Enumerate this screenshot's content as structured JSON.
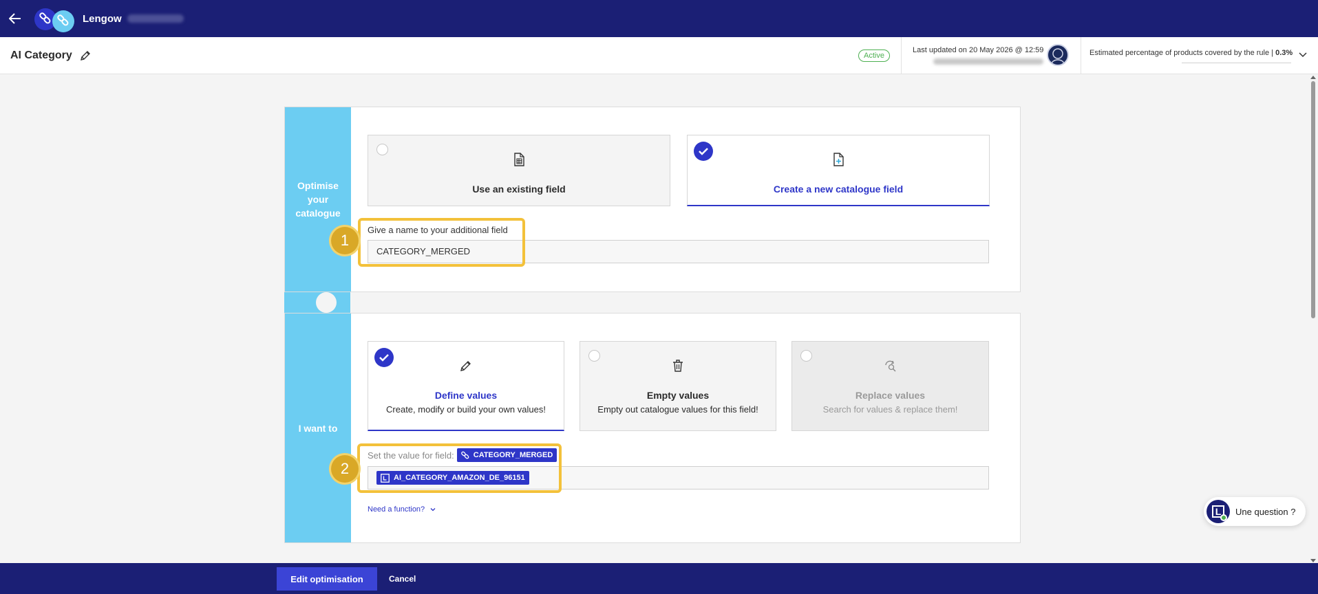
{
  "topbar": {
    "brand": "Lengow"
  },
  "header": {
    "title": "AI Category",
    "status": "Active",
    "last_updated": "Last updated on 20 May 2026 @ 12:59",
    "estimate_label": "Estimated percentage of products covered by the rule |",
    "estimate_value": "0.3%"
  },
  "section1": {
    "side_label": "Optimise your catalogue",
    "options": [
      {
        "title": "Use an existing field",
        "icon": "table-file-icon",
        "selected": false
      },
      {
        "title": "Create a new catalogue field",
        "icon": "file-plus-icon",
        "selected": true
      }
    ],
    "field_label": "Give a name to your additional field",
    "field_value": "CATEGORY_MERGED",
    "step": "1"
  },
  "section2": {
    "side_label": "I want to",
    "options": [
      {
        "title": "Define values",
        "subtitle": "Create, modify or build your own values!",
        "icon": "pencil-icon",
        "selected": true
      },
      {
        "title": "Empty values",
        "subtitle": "Empty out catalogue values for this field!",
        "icon": "trash-icon",
        "selected": false
      },
      {
        "title": "Replace values",
        "subtitle": "Search for values & replace them!",
        "icon": "replace-icon",
        "selected": false,
        "disabled": true
      }
    ],
    "set_value_label": "Set the value for field:",
    "field_chip": "CATEGORY_MERGED",
    "value_chip": "AI_CATEGORY_AMAZON_DE_96151",
    "need_function": "Need a function?",
    "step": "2"
  },
  "help": {
    "label": "Une question ?"
  },
  "footer": {
    "primary": "Edit optimisation",
    "cancel": "Cancel"
  },
  "colors": {
    "navy": "#1b1f75",
    "accent": "#2e36c8",
    "sky": "#6ccdf2",
    "highlight": "#f3c13a",
    "active": "#4caf50"
  }
}
